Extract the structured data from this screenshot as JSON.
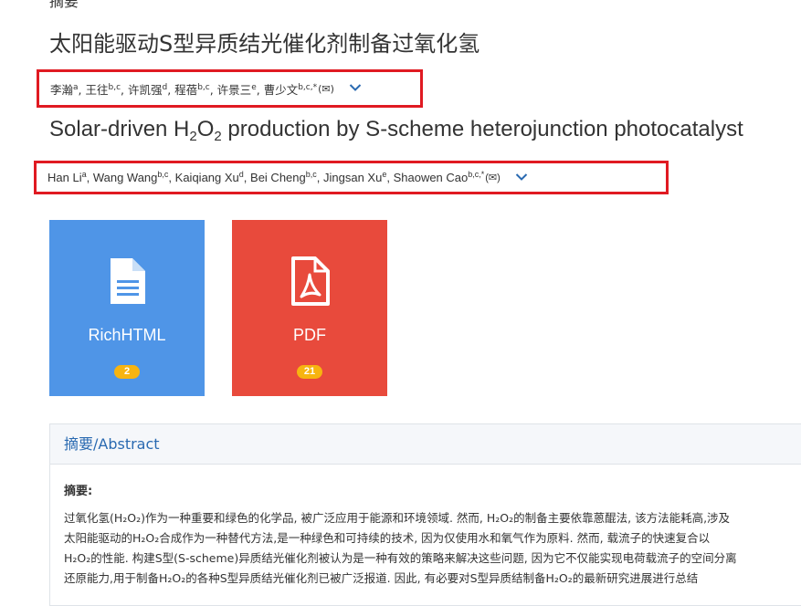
{
  "page": {
    "top_fragment": "摘要",
    "title_cn": "太阳能驱动S型异质结光催化剂制备过氧化氢",
    "title_en": {
      "before": "Solar-driven H",
      "sub1": "2",
      "mid": "O",
      "sub2": "2",
      "after": " production by S-scheme heterojunction photocatalyst"
    }
  },
  "authors_cn": [
    {
      "name": "李瀚",
      "sup": "a"
    },
    {
      "name": "王往",
      "sup": "b,c"
    },
    {
      "name": "许凯强",
      "sup": "d"
    },
    {
      "name": "程蓓",
      "sup": "b,c"
    },
    {
      "name": "许景三",
      "sup": "e"
    },
    {
      "name": "曹少文",
      "sup": "b,c,*"
    }
  ],
  "authors_en": [
    {
      "name": "Han Li",
      "sup": "a"
    },
    {
      "name": "Wang Wang",
      "sup": "b,c"
    },
    {
      "name": "Kaiqiang Xu",
      "sup": "d"
    },
    {
      "name": "Bei Cheng",
      "sup": "b,c"
    },
    {
      "name": "Jingsan Xu",
      "sup": "e"
    },
    {
      "name": "Shaowen Cao",
      "sup": "b,c,*"
    }
  ],
  "mail_glyph": "(✉)",
  "separator": ", ",
  "tiles": {
    "richhtml": {
      "label": "RichHTML",
      "count": "2",
      "color": "#4f95e7"
    },
    "pdf": {
      "label": "PDF",
      "count": "21",
      "color": "#e84a3c"
    }
  },
  "abstract": {
    "header": "摘要/Abstract",
    "label": "摘要:",
    "lines": [
      "过氧化氢(H₂O₂)作为一种重要和绿色的化学品, 被广泛应用于能源和环境领域. 然而, H₂O₂的制备主要依靠蒽醌法, 该方法能耗高,涉及",
      "太阳能驱动的H₂O₂合成作为一种替代方法,是一种绿色和可持续的技术, 因为仅使用水和氧气作为原料. 然而, 载流子的快速复合以",
      "H₂O₂的性能. 构建S型(S-scheme)异质结光催化剂被认为是一种有效的策略来解决这些问题, 因为它不仅能实现电荷载流子的空间分离",
      "还原能力,用于制备H₂O₂的各种S型异质结光催化剂已被广泛报道. 因此, 有必要对S型异质结制备H₂O₂的最新研究进展进行总结"
    ]
  }
}
